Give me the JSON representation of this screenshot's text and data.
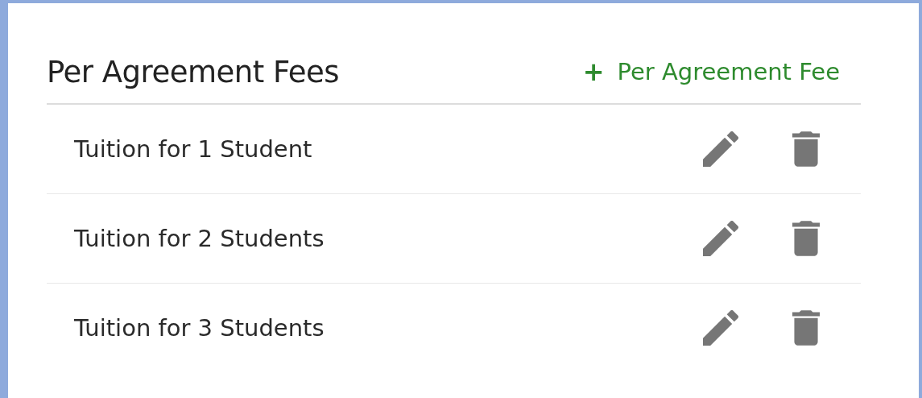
{
  "section": {
    "title": "Per Agreement Fees",
    "add_button": {
      "icon": "+",
      "label": "Per Agreement Fee"
    }
  },
  "fees": [
    {
      "name": "Tuition for 1 Student"
    },
    {
      "name": "Tuition for 2 Students"
    },
    {
      "name": "Tuition for 3 Students"
    }
  ]
}
